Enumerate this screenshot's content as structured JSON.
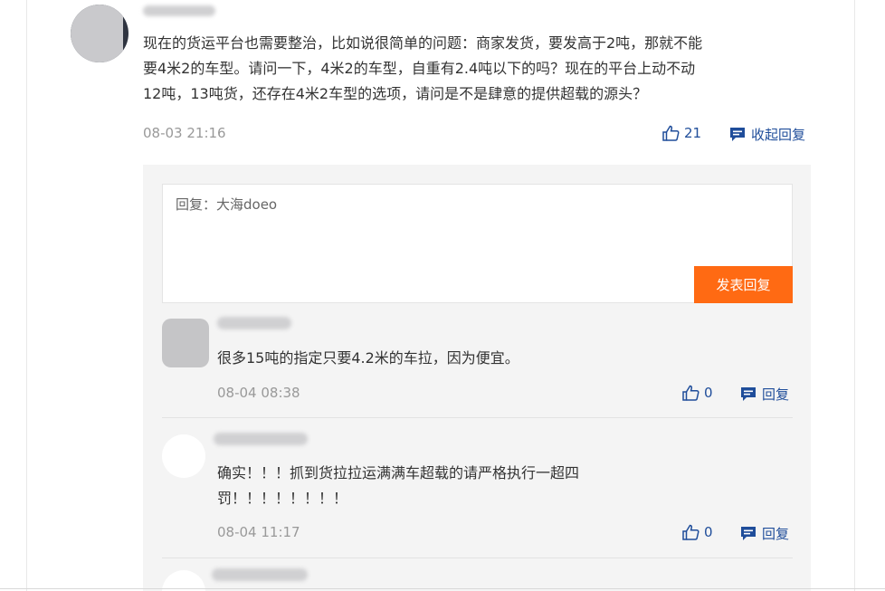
{
  "main_comment": {
    "text_lines": [
      "现在的货运平台也需要整治，比如说很简单的问题：商家发货，要发高于2吨，那就不能",
      "要4米2的车型。请问一下，4米2的车型，自重有2.4吨以下的吗？现在的平台上动不动",
      "12吨，13吨货，还存在4米2车型的选项，请问是不是肆意的提供超载的源头？"
    ],
    "time": "08-03 21:16",
    "likes": "21",
    "collapse_label": "收起回复"
  },
  "reply_form": {
    "placeholder": "回复：大海doeo",
    "submit_label": "发表回复"
  },
  "replies": [
    {
      "text_lines": [
        "很多15吨的指定只要4.2米的车拉，因为便宜。"
      ],
      "time": "08-04 08:38",
      "likes": "0",
      "reply_label": "回复"
    },
    {
      "text_lines": [
        "确实！！！抓到货拉拉运满满车超载的请严格执行一超四",
        "罚！！！！！！！！"
      ],
      "time": "08-04 11:17",
      "likes": "0",
      "reply_label": "回复"
    }
  ],
  "colors": {
    "link_blue": "#1f4d9a",
    "submit_orange": "#ff6a13",
    "meta_gray": "#999999",
    "panel_bg": "#f4f4f4"
  },
  "icons": {
    "like": "thumbs-up-icon",
    "reply": "comment-bubble-icon"
  }
}
